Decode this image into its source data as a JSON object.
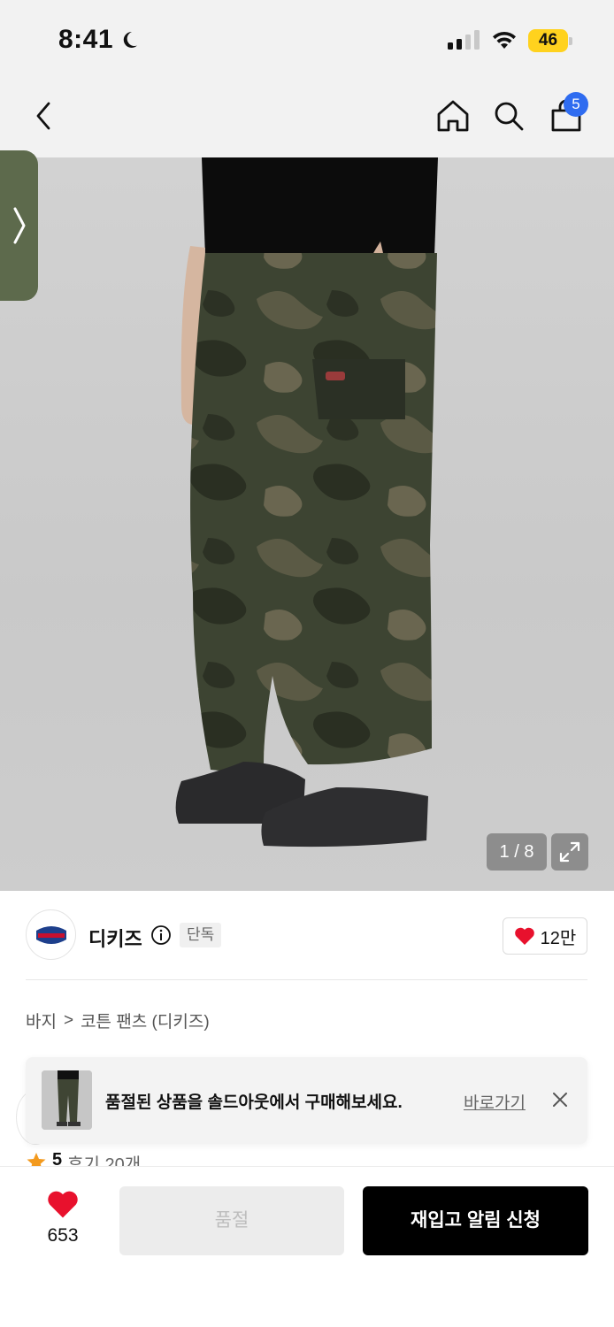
{
  "status_bar": {
    "time": "8:41",
    "battery": "46"
  },
  "nav": {
    "cart_count": "5"
  },
  "image": {
    "counter": "1 / 8"
  },
  "brand": {
    "name": "디키즈",
    "exclusive_badge": "단독",
    "likes": "12만"
  },
  "breadcrumb": {
    "category": "바지",
    "separator": ">",
    "subcategory": "코튼 팬츠 (디키즈)"
  },
  "toast": {
    "message": "품절된 상품을 솔드아웃에서 구매해보세요.",
    "link": "바로가기"
  },
  "rating": {
    "score": "5",
    "reviews": "후기 20개"
  },
  "bottom": {
    "wish_count": "653",
    "soldout_label": "품절",
    "restock_label": "재입고 알림 신청"
  },
  "colors": {
    "accent_red": "#e8112d",
    "badge_blue": "#2f6cf0",
    "battery_yellow": "#ffd21e"
  }
}
